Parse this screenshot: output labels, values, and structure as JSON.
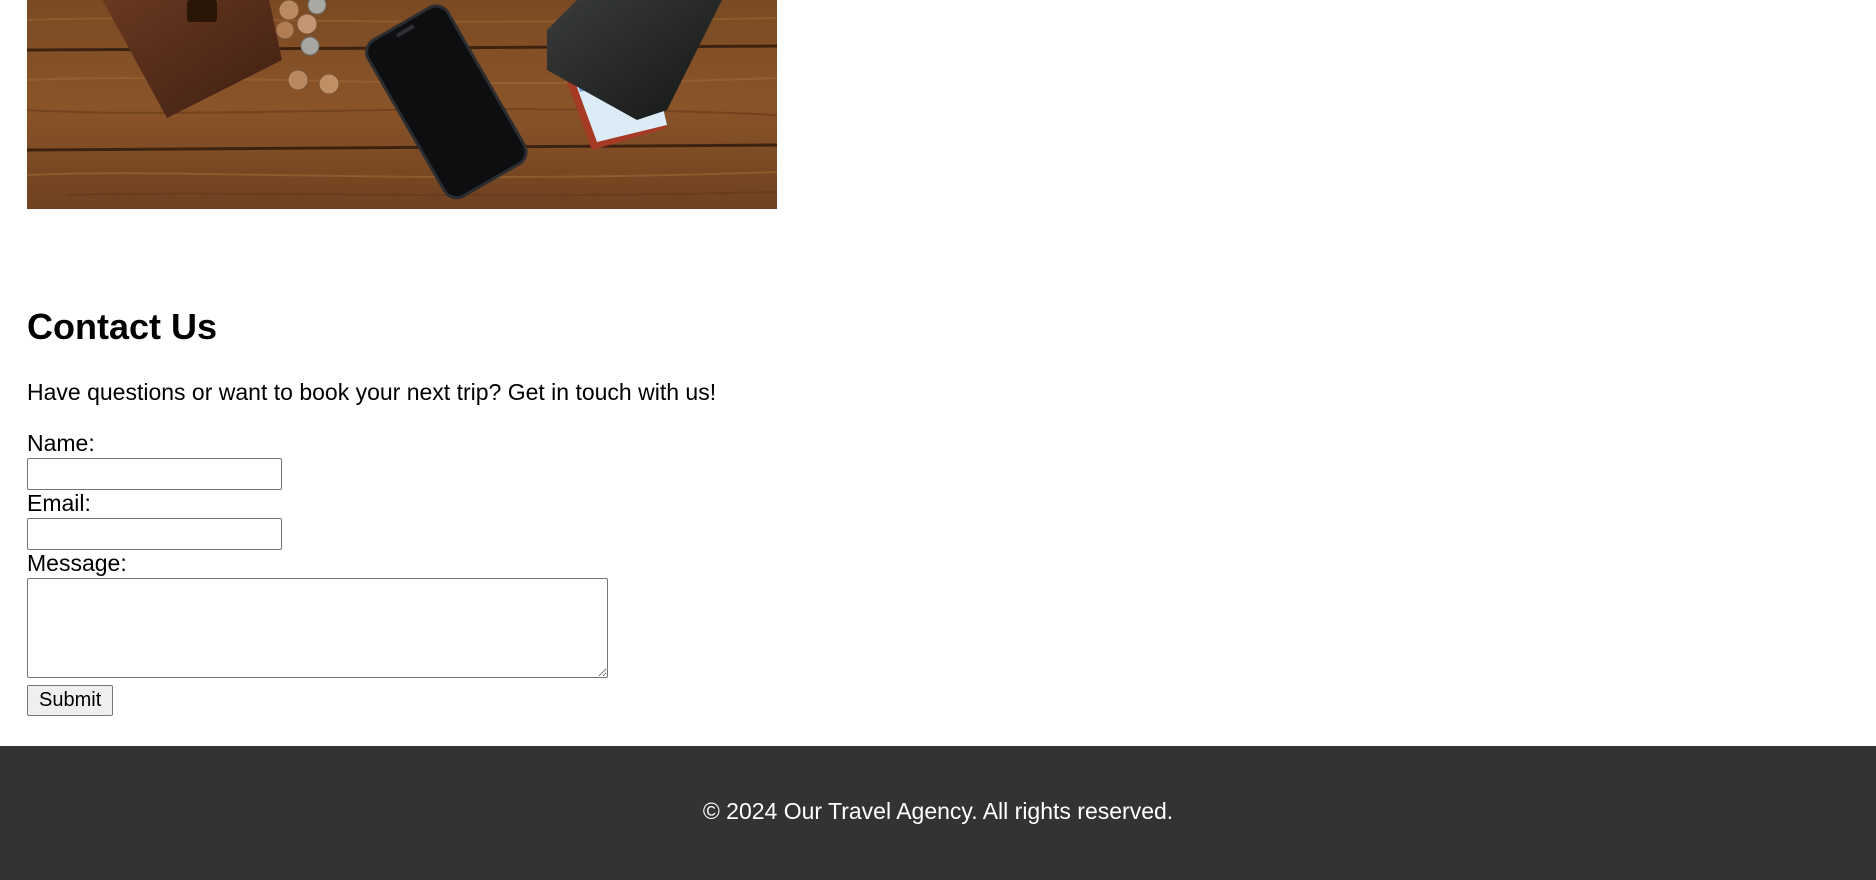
{
  "hero": {
    "image_alt": "Wallet, coins, smartphone and passport on a wooden table"
  },
  "contact": {
    "heading": "Contact Us",
    "intro": "Have questions or want to book your next trip? Get in touch with us!",
    "name_label": "Name:",
    "name_value": "",
    "email_label": "Email:",
    "email_value": "",
    "message_label": "Message:",
    "message_value": "",
    "submit_label": "Submit"
  },
  "footer": {
    "copyright": "© 2024 Our Travel Agency. All rights reserved.",
    "background_color": "#333333"
  }
}
